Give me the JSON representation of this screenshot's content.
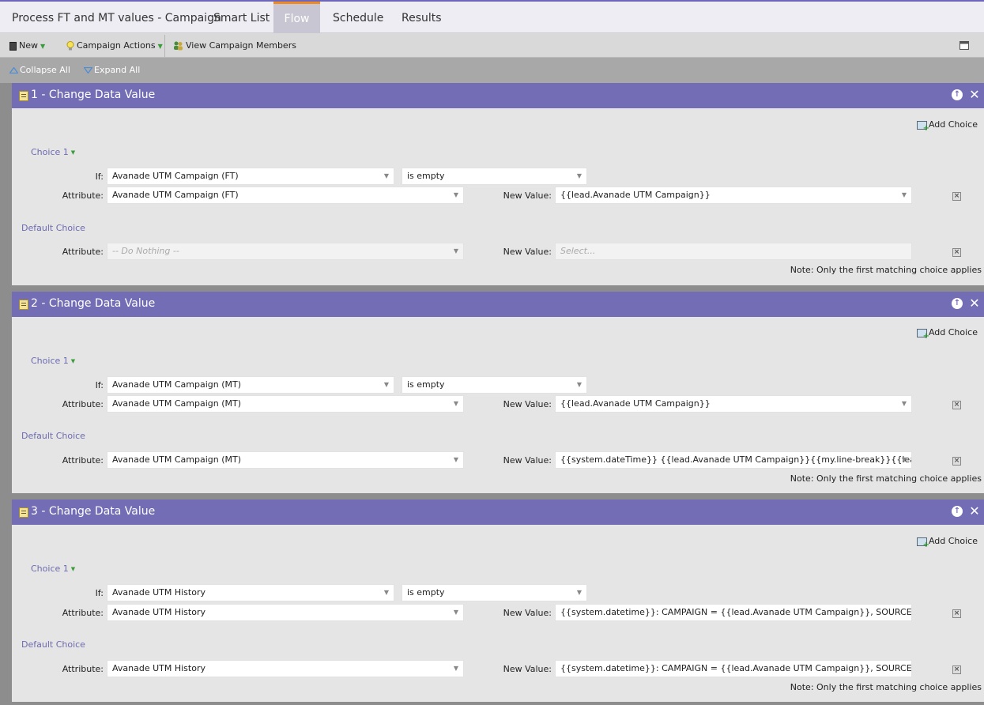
{
  "tabs": [
    {
      "label": "Process FT and MT values - Campaign",
      "active": false
    },
    {
      "label": "Smart List",
      "active": false
    },
    {
      "label": "Flow",
      "active": true
    },
    {
      "label": "Schedule",
      "active": false
    },
    {
      "label": "Results",
      "active": false
    }
  ],
  "toolbar": {
    "new_label": "New",
    "campaign_actions_label": "Campaign Actions",
    "view_members_label": "View Campaign Members"
  },
  "collapse": {
    "collapse_all": "Collapse All",
    "expand_all": "Expand All"
  },
  "common": {
    "add_choice": "Add Choice",
    "choice_label": "Choice 1",
    "default_choice": "Default Choice",
    "if_label": "If:",
    "attribute_label": "Attribute:",
    "new_value_label": "New Value:",
    "note": "Note: Only the first matching choice applies"
  },
  "steps": [
    {
      "title": "1 - Change Data Value",
      "choice": {
        "if_field": "Avanade UTM Campaign (FT)",
        "operator": "is empty",
        "attribute": "Avanade UTM Campaign (FT)",
        "new_value": "{{lead.Avanade UTM Campaign}}"
      },
      "default": {
        "attribute": "-- Do Nothing --",
        "new_value_placeholder": "Select..."
      }
    },
    {
      "title": "2 - Change Data Value",
      "choice": {
        "if_field": "Avanade UTM Campaign (MT)",
        "operator": "is empty",
        "attribute": "Avanade UTM Campaign (MT)",
        "new_value": "{{lead.Avanade UTM Campaign}}"
      },
      "default": {
        "attribute": "Avanade UTM Campaign (MT)",
        "new_value": "{{system.dateTime}} {{lead.Avanade UTM Campaign}}{{my.line-break}}{{lead.Avan"
      }
    },
    {
      "title": "3 - Change Data Value",
      "choice": {
        "if_field": "Avanade UTM History",
        "operator": "is empty",
        "attribute": "Avanade UTM History",
        "new_value": "{{system.datetime}}: CAMPAIGN = {{lead.Avanade UTM Campaign}}, SOURCE = {{lead"
      },
      "default": {
        "attribute": "Avanade UTM History",
        "new_value": "{{system.datetime}}: CAMPAIGN = {{lead.Avanade UTM Campaign}}, SOURCE = {{lead"
      }
    }
  ],
  "colors": {
    "header_purple": "#726db5",
    "active_tab_accent": "#f08a24",
    "choice_link": "#6c6ab0"
  }
}
